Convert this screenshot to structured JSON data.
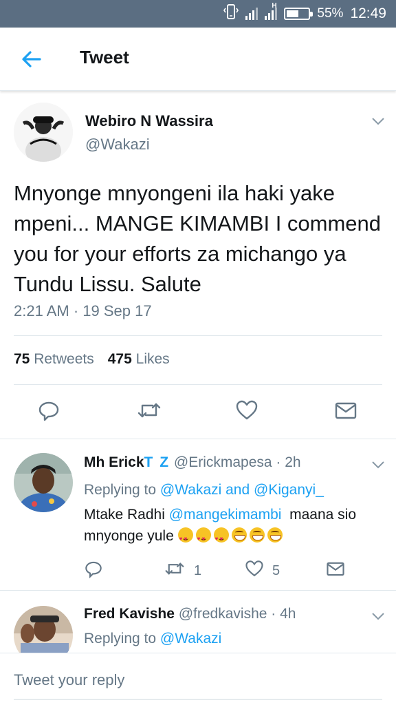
{
  "status_bar": {
    "battery": "55%",
    "battery_level": 0.55,
    "time": "12:49",
    "signal_label": "H"
  },
  "header": {
    "title": "Tweet",
    "back_icon": "back-arrow-icon"
  },
  "main_tweet": {
    "author_name": "Webiro N Wassira",
    "author_handle": "@Wakazi",
    "text": "Mnyonge mnyongeni ila haki yake mpeni... MANGE KIMAMBI I commend you for your efforts za michango ya Tundu Lissu. Salute",
    "timestamp": "2:21 AM · 19 Sep 17",
    "retweets_count": "75",
    "retweets_label": "Retweets",
    "likes_count": "475",
    "likes_label": "Likes",
    "actions": [
      "reply-icon",
      "retweet-icon",
      "like-icon",
      "message-icon"
    ]
  },
  "replies": [
    {
      "name": "Mh Erick",
      "name_suffix": "T Z",
      "handle": "@Erickmapesa",
      "time": "2h",
      "replying_prefix": "Replying to",
      "replying_to": "@Wakazi and @Kiganyi_",
      "text_prefix": "Mtake Radhi",
      "mention": "@mangekimambi",
      "text_suffix": "maana sio mnyonge yule",
      "retweets": "1",
      "likes": "5"
    },
    {
      "name": "Fred Kavishe",
      "handle": "@fredkavishe",
      "time": "4h",
      "replying_prefix": "Replying to",
      "replying_to": "@Wakazi"
    }
  ],
  "composer": {
    "placeholder": "Tweet your reply"
  },
  "colors": {
    "accent": "#1da1f2",
    "status_bar": "#5b6e82",
    "secondary_text": "#657786"
  }
}
